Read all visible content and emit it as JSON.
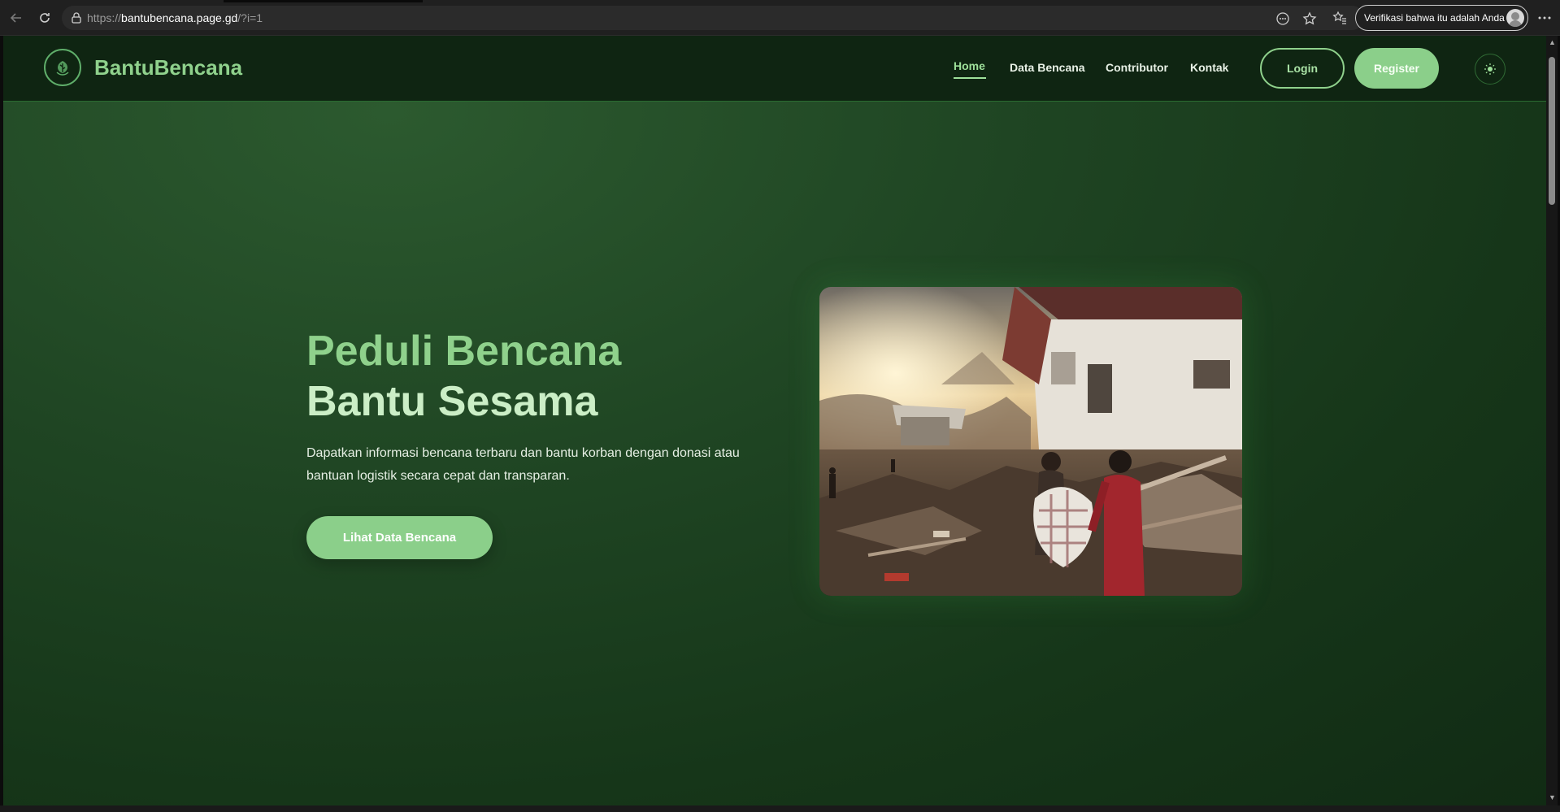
{
  "browser": {
    "url_scheme": "https://",
    "url_host": "bantubencana.page.gd",
    "url_path": "/?i=1",
    "profile_label": "Verifikasi bahwa itu adalah Anda"
  },
  "site": {
    "brand": "BantuBencana",
    "nav": {
      "home": "Home",
      "data_bencana": "Data Bencana",
      "contributor": "Contributor",
      "kontak": "Kontak"
    },
    "login_label": "Login",
    "register_label": "Register"
  },
  "hero": {
    "title_line1": "Peduli Bencana",
    "title_line2": "Bantu Sesama",
    "description": "Dapatkan informasi bencana terbaru dan bantu korban dengan donasi atau bantuan logistik secara cepat dan transparan.",
    "cta_label": "Lihat Data Bencana"
  },
  "colors": {
    "accent": "#8bcf8a",
    "header_bg": "#0f2512",
    "page_bg": "#1f4523"
  },
  "icons": [
    "back-icon",
    "reload-icon",
    "lock-icon",
    "reader-icon",
    "star-icon",
    "favorites-icon",
    "more-icon",
    "leaf-logo-icon",
    "theme-toggle-icon"
  ]
}
